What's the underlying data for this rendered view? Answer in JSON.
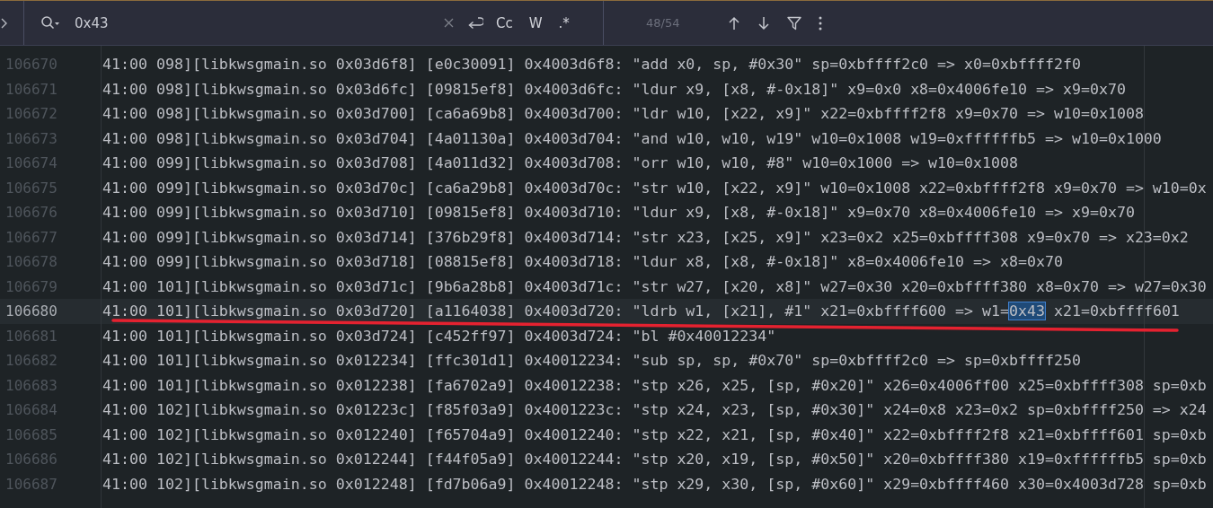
{
  "search": {
    "value": "0x43",
    "options": [
      {
        "label": "Cc",
        "selected": false
      },
      {
        "label": "W",
        "selected": false
      },
      {
        "label": ".*",
        "selected": false
      }
    ],
    "match_count": "48/54"
  },
  "lines": [
    {
      "number": "106670",
      "current": false,
      "text": "41:00 098][libkwsgmain.so 0x03d6f8] [e0c30091] 0x4003d6f8: \"add x0, sp, #0x30\" sp=0xbffff2c0 => x0=0xbffff2f0"
    },
    {
      "number": "106671",
      "current": false,
      "text": "41:00 098][libkwsgmain.so 0x03d6fc] [09815ef8] 0x4003d6fc: \"ldur x9, [x8, #-0x18]\" x9=0x0 x8=0x4006fe10 => x9=0x70"
    },
    {
      "number": "106672",
      "current": false,
      "text": "41:00 098][libkwsgmain.so 0x03d700] [ca6a69b8] 0x4003d700: \"ldr w10, [x22, x9]\" x22=0xbffff2f8 x9=0x70 => w10=0x1008"
    },
    {
      "number": "106673",
      "current": false,
      "text": "41:00 098][libkwsgmain.so 0x03d704] [4a01130a] 0x4003d704: \"and w10, w10, w19\" w10=0x1008 w19=0xffffffb5 => w10=0x1000"
    },
    {
      "number": "106674",
      "current": false,
      "text": "41:00 099][libkwsgmain.so 0x03d708] [4a011d32] 0x4003d708: \"orr w10, w10, #8\" w10=0x1000 => w10=0x1008"
    },
    {
      "number": "106675",
      "current": false,
      "text": "41:00 099][libkwsgmain.so 0x03d70c] [ca6a29b8] 0x4003d70c: \"str w10, [x22, x9]\" w10=0x1008 x22=0xbffff2f8 x9=0x70 => w10=0x"
    },
    {
      "number": "106676",
      "current": false,
      "text": "41:00 099][libkwsgmain.so 0x03d710] [09815ef8] 0x4003d710: \"ldur x9, [x8, #-0x18]\" x9=0x70 x8=0x4006fe10 => x9=0x70"
    },
    {
      "number": "106677",
      "current": false,
      "text": "41:00 099][libkwsgmain.so 0x03d714] [376b29f8] 0x4003d714: \"str x23, [x25, x9]\" x23=0x2 x25=0xbffff308 x9=0x70 => x23=0x2"
    },
    {
      "number": "106678",
      "current": false,
      "text": "41:00 099][libkwsgmain.so 0x03d718] [08815ef8] 0x4003d718: \"ldur x8, [x8, #-0x18]\" x8=0x4006fe10 => x8=0x70"
    },
    {
      "number": "106679",
      "current": false,
      "text": "41:00 101][libkwsgmain.so 0x03d71c] [9b6a28b8] 0x4003d71c: \"str w27, [x20, x8]\" w27=0x30 x20=0xbffff380 x8=0x70 => w27=0x30"
    },
    {
      "number": "106680",
      "current": true,
      "text": "41:00 101][libkwsgmain.so 0x03d720] [a1164038] 0x4003d720: \"ldrb w1, [x21], #1\" x21=0xbffff600 => w1=",
      "match": "0x43",
      "after": "x21=0xbffff601"
    },
    {
      "number": "106681",
      "current": false,
      "text": "41:00 101][libkwsgmain.so 0x03d724] [c452ff97] 0x4003d724: \"bl #0x40012234\""
    },
    {
      "number": "106682",
      "current": false,
      "text": "41:00 101][libkwsgmain.so 0x012234] [ffc301d1] 0x40012234: \"sub sp, sp, #0x70\" sp=0xbffff2c0 => sp=0xbffff250"
    },
    {
      "number": "106683",
      "current": false,
      "text": "41:00 101][libkwsgmain.so 0x012238] [fa6702a9] 0x40012238: \"stp x26, x25, [sp, #0x20]\" x26=0x4006ff00 x25=0xbffff308 sp=0xb"
    },
    {
      "number": "106684",
      "current": false,
      "text": "41:00 102][libkwsgmain.so 0x01223c] [f85f03a9] 0x4001223c: \"stp x24, x23, [sp, #0x30]\" x24=0x8 x23=0x2 sp=0xbffff250 => x24"
    },
    {
      "number": "106685",
      "current": false,
      "text": "41:00 102][libkwsgmain.so 0x012240] [f65704a9] 0x40012240: \"stp x22, x21, [sp, #0x40]\" x22=0xbffff2f8 x21=0xbffff601 sp=0xb"
    },
    {
      "number": "106686",
      "current": false,
      "text": "41:00 102][libkwsgmain.so 0x012244] [f44f05a9] 0x40012244: \"stp x20, x19, [sp, #0x50]\" x20=0xbffff380 x19=0xffffffb5 sp=0xb"
    },
    {
      "number": "106687",
      "current": false,
      "text": "41:00 102][libkwsgmain.so 0x012248] [fd7b06a9] 0x40012248: \"stp x29, x30, [sp, #0x60]\" x29=0xbffff460 x30=0x4003d728 sp=0xb"
    }
  ]
}
